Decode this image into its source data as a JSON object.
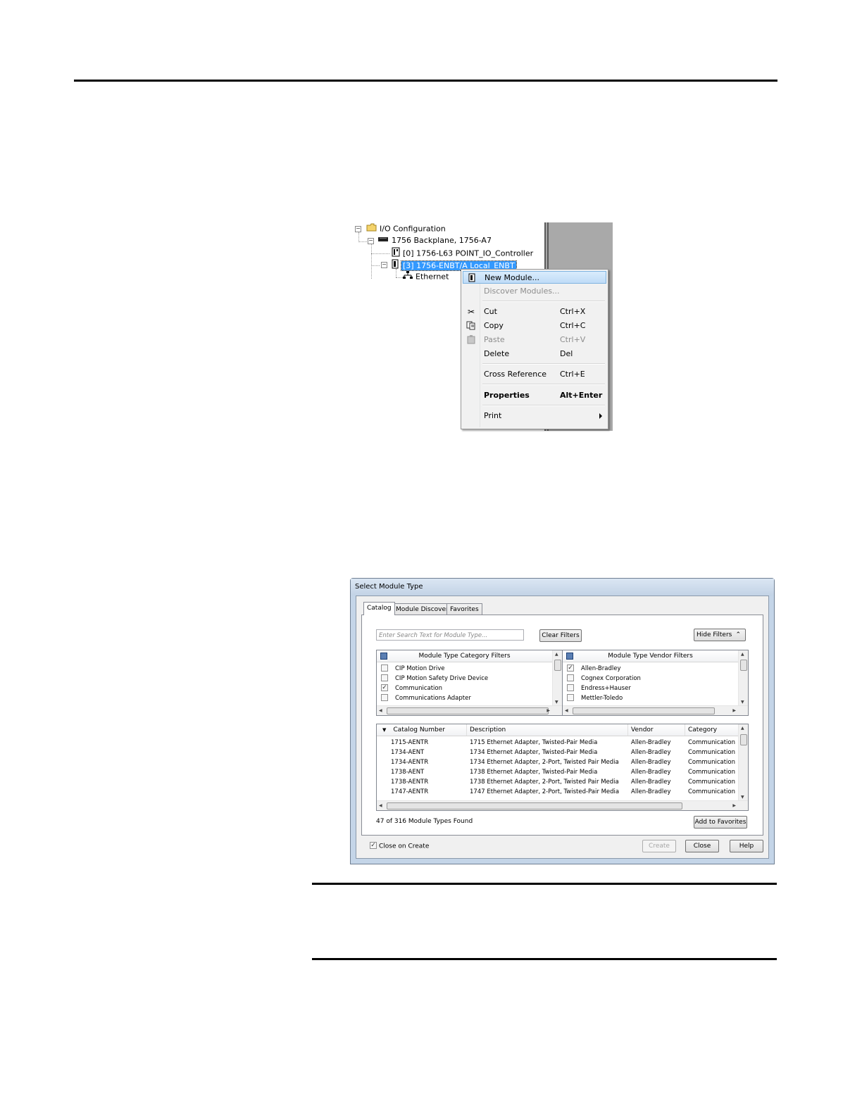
{
  "tree": {
    "items": [
      {
        "label": "I/O Configuration"
      },
      {
        "label": "1756 Backplane, 1756-A7"
      },
      {
        "label": "[0] 1756-L63 POINT_IO_Controller"
      },
      {
        "label": "[3] 1756-ENBT/A Local_ENBT"
      },
      {
        "label": "Ethernet"
      }
    ]
  },
  "context_menu": {
    "items": [
      {
        "label": "New Module...",
        "shortcut": ""
      },
      {
        "label": "Discover Modules...",
        "shortcut": ""
      },
      {
        "label": "Cut",
        "shortcut": "Ctrl+X"
      },
      {
        "label": "Copy",
        "shortcut": "Ctrl+C"
      },
      {
        "label": "Paste",
        "shortcut": "Ctrl+V"
      },
      {
        "label": "Delete",
        "shortcut": "Del"
      },
      {
        "label": "Cross Reference",
        "shortcut": "Ctrl+E"
      },
      {
        "label": "Properties",
        "shortcut": "Alt+Enter"
      },
      {
        "label": "Print",
        "shortcut": ""
      }
    ]
  },
  "dialog": {
    "title": "Select Module Type",
    "tabs": [
      "Catalog",
      "Module Discovery",
      "Favorites"
    ],
    "search_placeholder": "Enter Search Text for Module Type...",
    "clear_filters": "Clear Filters",
    "hide_filters": "Hide Filters",
    "category_filters": {
      "header": "Module Type Category Filters",
      "items": [
        {
          "label": "CIP Motion Drive",
          "checked": false
        },
        {
          "label": "CIP Motion Safety Drive Device",
          "checked": false
        },
        {
          "label": "Communication",
          "checked": true
        },
        {
          "label": "Communications Adapter",
          "checked": false
        }
      ]
    },
    "vendor_filters": {
      "header": "Module Type Vendor Filters",
      "items": [
        {
          "label": "Allen-Bradley",
          "checked": true
        },
        {
          "label": "Cognex Corporation",
          "checked": false
        },
        {
          "label": "Endress+Hauser",
          "checked": false
        },
        {
          "label": "Mettler-Toledo",
          "checked": false
        }
      ]
    },
    "table": {
      "columns": [
        "Catalog Number",
        "Description",
        "Vendor",
        "Category"
      ],
      "rows": [
        [
          "1715-AENTR",
          "1715 Ethernet Adapter, Twisted-Pair Media",
          "Allen-Bradley",
          "Communication"
        ],
        [
          "1734-AENT",
          "1734 Ethernet Adapter, Twisted-Pair Media",
          "Allen-Bradley",
          "Communication"
        ],
        [
          "1734-AENTR",
          "1734 Ethernet Adapter, 2-Port, Twisted Pair Media",
          "Allen-Bradley",
          "Communication"
        ],
        [
          "1738-AENT",
          "1738 Ethernet Adapter, Twisted-Pair Media",
          "Allen-Bradley",
          "Communication"
        ],
        [
          "1738-AENTR",
          "1738 Ethernet Adapter, 2-Port, Twisted Pair Media",
          "Allen-Bradley",
          "Communication"
        ],
        [
          "1747-AENTR",
          "1747 Ethernet Adapter, 2-Port, Twisted-Pair Media",
          "Allen-Bradley",
          "Communication"
        ]
      ]
    },
    "found_text": "47 of 316 Module Types Found",
    "add_to_favorites": "Add to Favorites",
    "close_on_create": "Close on Create",
    "close_on_create_checked": true,
    "buttons": {
      "create": "Create",
      "close": "Close",
      "help": "Help"
    }
  }
}
